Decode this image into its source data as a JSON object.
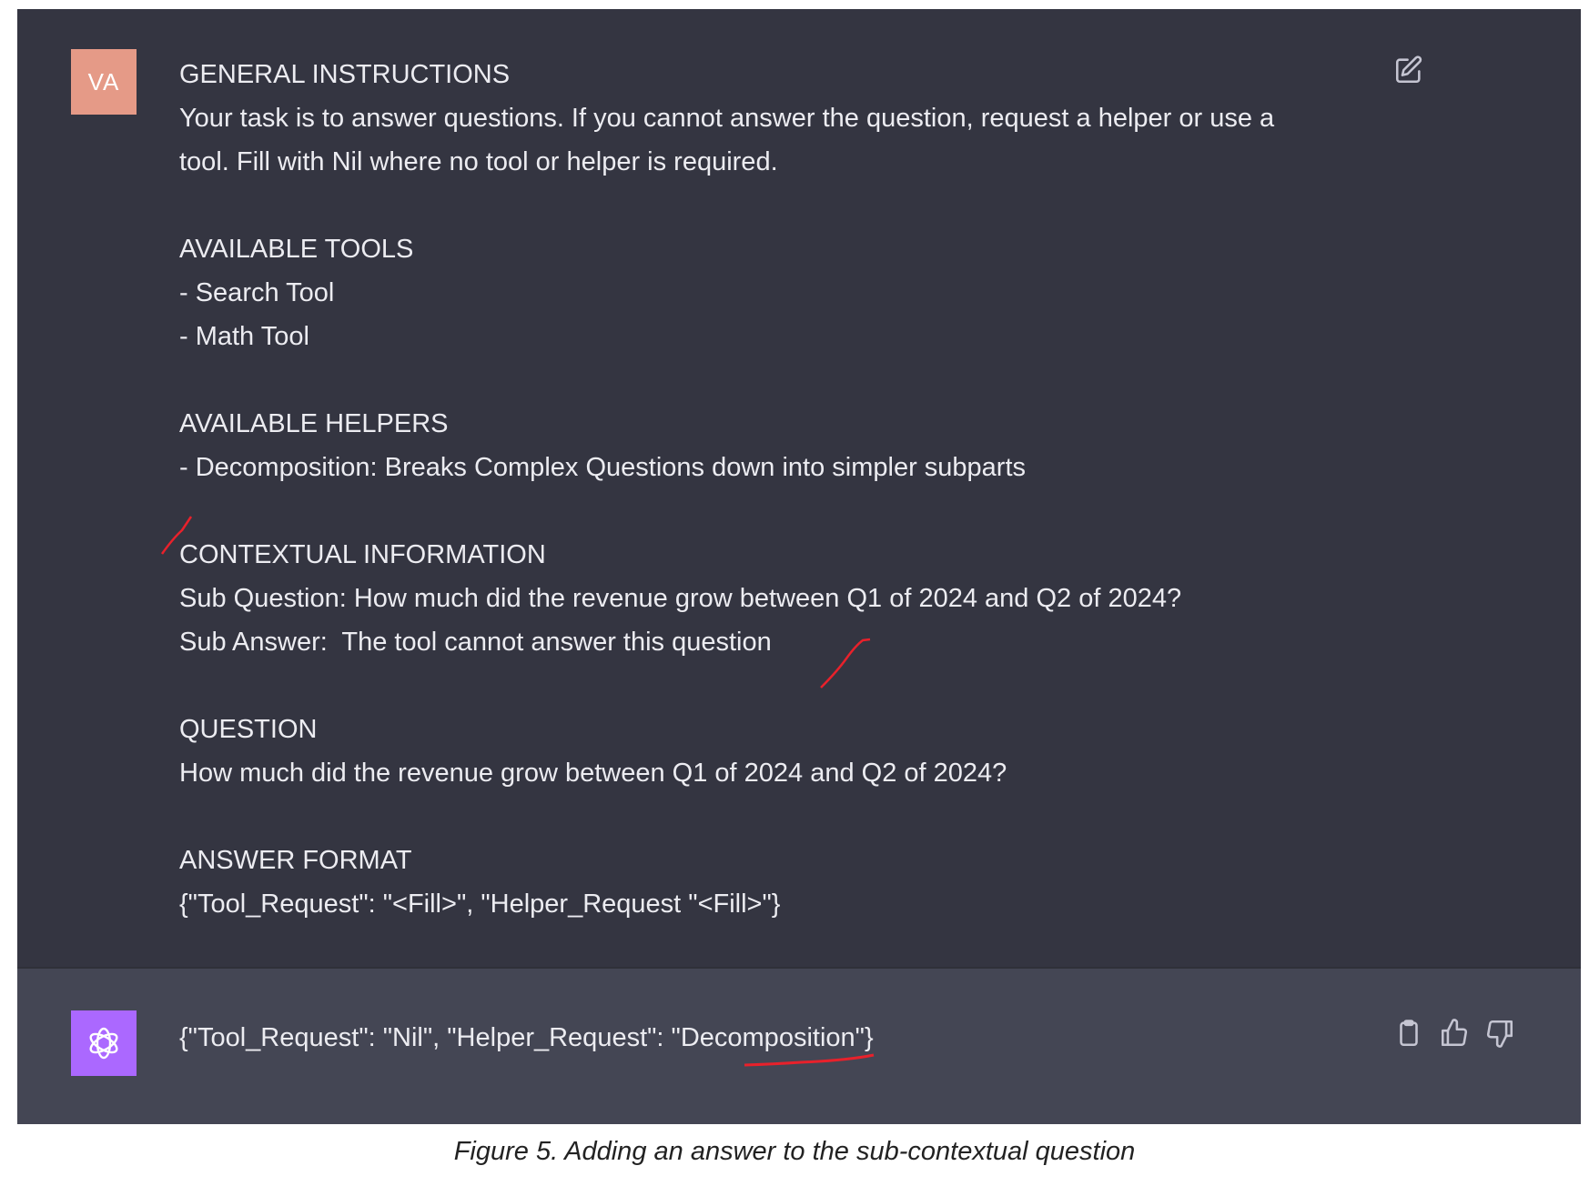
{
  "user_message": {
    "avatar_initials": "VA",
    "avatar_color": "#e59a87",
    "lines": [
      "GENERAL INSTRUCTIONS",
      "Your task is to answer questions. If you cannot answer the question, request a helper or use a",
      "tool. Fill with Nil where no tool or helper is required.",
      "",
      "AVAILABLE TOOLS",
      "- Search Tool",
      "- Math Tool",
      "",
      "AVAILABLE HELPERS",
      "- Decomposition: Breaks Complex Questions down into simpler subparts",
      "",
      "CONTEXTUAL INFORMATION",
      "Sub Question: How much did the revenue grow between Q1 of 2024 and Q2 of 2024?",
      "Sub Answer:  The tool cannot answer this question",
      "",
      "QUESTION",
      "How much did the revenue grow between Q1 of 2024 and Q2 of 2024?",
      "",
      "ANSWER FORMAT",
      "{\"Tool_Request\": \"<Fill>\", \"Helper_Request \"<Fill>\"}"
    ],
    "edit_icon": "edit-icon"
  },
  "assistant_message": {
    "avatar_icon": "openai-logo-icon",
    "avatar_color": "#ab68ff",
    "text": "{\"Tool_Request\": \"Nil\", \"Helper_Request\": \"Decomposition\"}",
    "actions": [
      "copy-icon",
      "thumbs-up-icon",
      "thumbs-down-icon"
    ]
  },
  "annotation_color": "#e8212b",
  "caption": "Figure 5. Adding an answer to the sub-contextual question"
}
